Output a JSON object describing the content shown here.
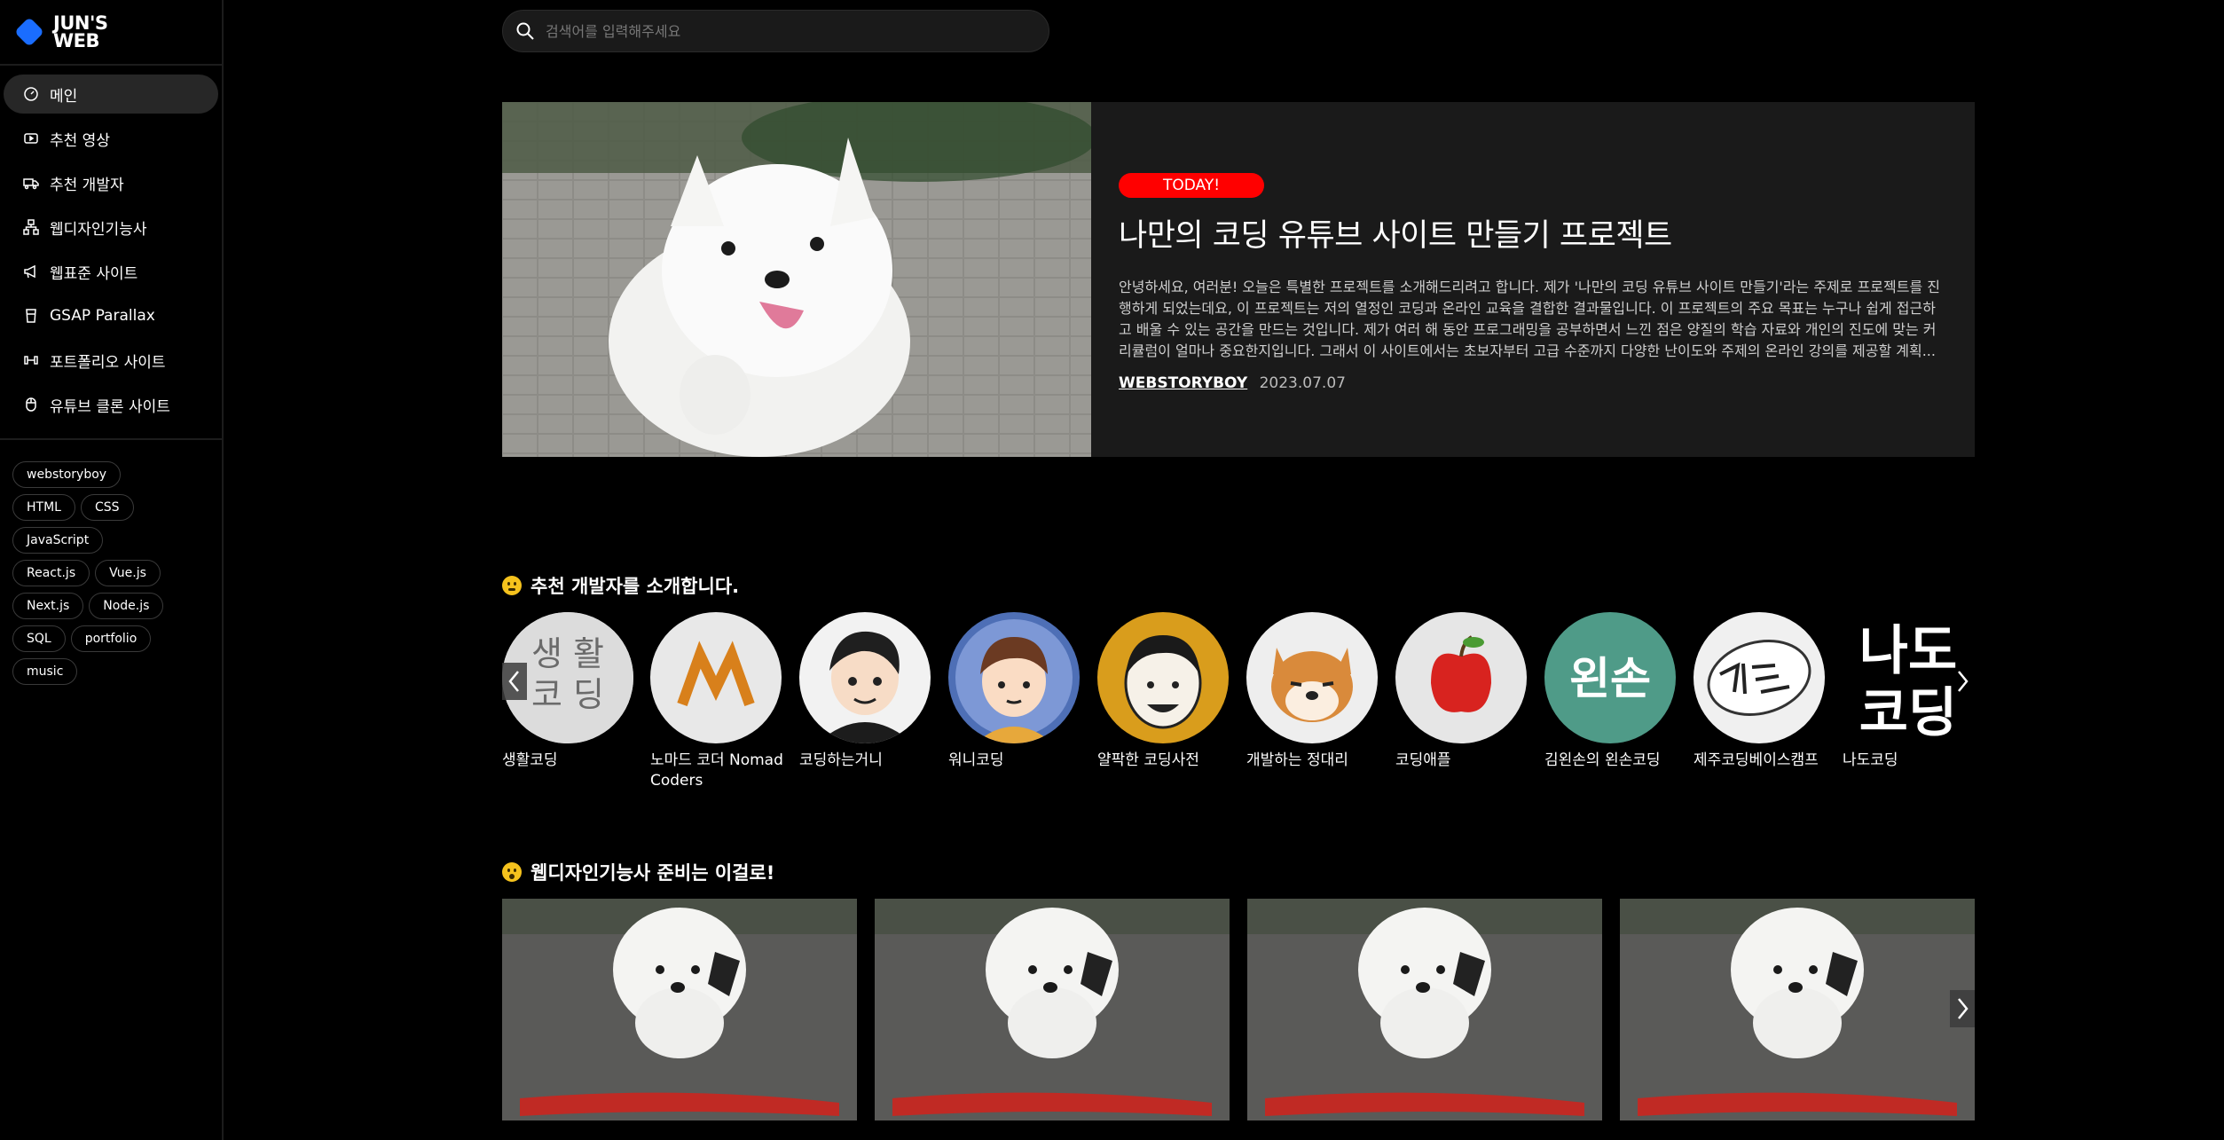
{
  "brand": {
    "line1": "JUN'S",
    "line2": "WEB",
    "color": "#1a6dff"
  },
  "nav": [
    {
      "label": "메인",
      "icon": "dashboard-icon",
      "active": true
    },
    {
      "label": "추천 영상",
      "icon": "video-icon"
    },
    {
      "label": "추천 개발자",
      "icon": "truck-icon"
    },
    {
      "label": "웹디자인기능사",
      "icon": "sitemap-icon"
    },
    {
      "label": "웹표준 사이트",
      "icon": "megaphone-icon"
    },
    {
      "label": "GSAP Parallax",
      "icon": "cup-icon"
    },
    {
      "label": "포트폴리오 사이트",
      "icon": "dumbbell-icon"
    },
    {
      "label": "유튜브 클론 사이트",
      "icon": "mouse-icon"
    }
  ],
  "tags": [
    "webstoryboy",
    "HTML",
    "CSS",
    "JavaScript",
    "React.js",
    "Vue.js",
    "Next.js",
    "Node.js",
    "SQL",
    "portfolio",
    "music"
  ],
  "search": {
    "placeholder": "검색어를 입력해주세요"
  },
  "hero": {
    "badge": "TODAY!",
    "title": "나만의 코딩 유튜브 사이트 만들기 프로젝트",
    "desc": "안녕하세요, 여러분! 오늘은 특별한 프로젝트를 소개해드리려고 합니다. 제가 '나만의 코딩 유튜브 사이트 만들기'라는 주제로 프로젝트를 진행하게 되었는데요, 이 프로젝트는 저의 열정인 코딩과 온라인 교육을 결합한 결과물입니다. 이 프로젝트의 주요 목표는 누구나 쉽게 접근하고 배울 수 있는 공간을 만드는 것입니다. 제가 여러 해 동안 프로그래밍을 공부하면서 느낀 점은 양질의 학습 자료와 개인의 진도에 맞는 커리큘럼이 얼마나 중요한지입니다. 그래서 이 사이트에서는 초보자부터 고급 수준까지 다양한 난이도와 주제의 온라인 강의를 제공할 계획...",
    "author": "WEBSTORYBOY",
    "date": "2023.07.07"
  },
  "developers_section": {
    "title": "추천 개발자를 소개합니다.",
    "items": [
      {
        "name": "생활코딩",
        "logo_text": "생 활 코 딩"
      },
      {
        "name": "노마드 코더 Nomad Coders"
      },
      {
        "name": "코딩하는거니"
      },
      {
        "name": "워니코딩"
      },
      {
        "name": "얄팍한 코딩사전"
      },
      {
        "name": "개발하는 정대리"
      },
      {
        "name": "코딩애플"
      },
      {
        "name": "김왼손의 왼손코딩",
        "logo_text": "왼손"
      },
      {
        "name": "제주코딩베이스캠프"
      },
      {
        "name": "나도코딩",
        "logo_text": "나도 코딩"
      }
    ]
  },
  "webdesign_section": {
    "title": "웹디자인기능사 준비는 이걸로!",
    "cards": 4
  }
}
